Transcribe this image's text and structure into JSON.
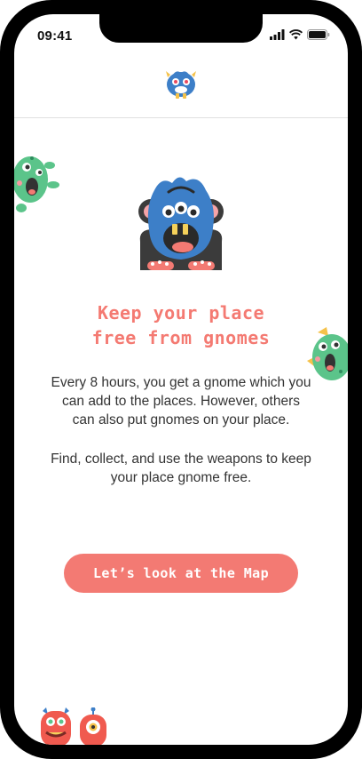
{
  "status_bar": {
    "time": "09:41"
  },
  "onboarding": {
    "headline_line1": "Keep your place",
    "headline_line2": "free from gnomes",
    "paragraph1": "Every 8 hours, you get a gnome which you can add to the places. However, others can also put gnomes on your place.",
    "paragraph2": "Find, collect, and use the weapons to keep your place gnome free.",
    "cta_label": "Let’s look at the Map"
  },
  "icons": {
    "header": "blue-monster-logo-icon",
    "hero": "blue-monster-icon",
    "left_peek": "green-monster-icon",
    "right_peek": "green-monster-icon",
    "bottom_left": "red-monster-icon",
    "bottom_left_2": "red-cyclops-monster-icon"
  },
  "colors": {
    "accent": "#f37a73",
    "monster_blue": "#3d7fc8",
    "monster_green": "#5bc48a",
    "monster_red": "#f05a4f"
  }
}
